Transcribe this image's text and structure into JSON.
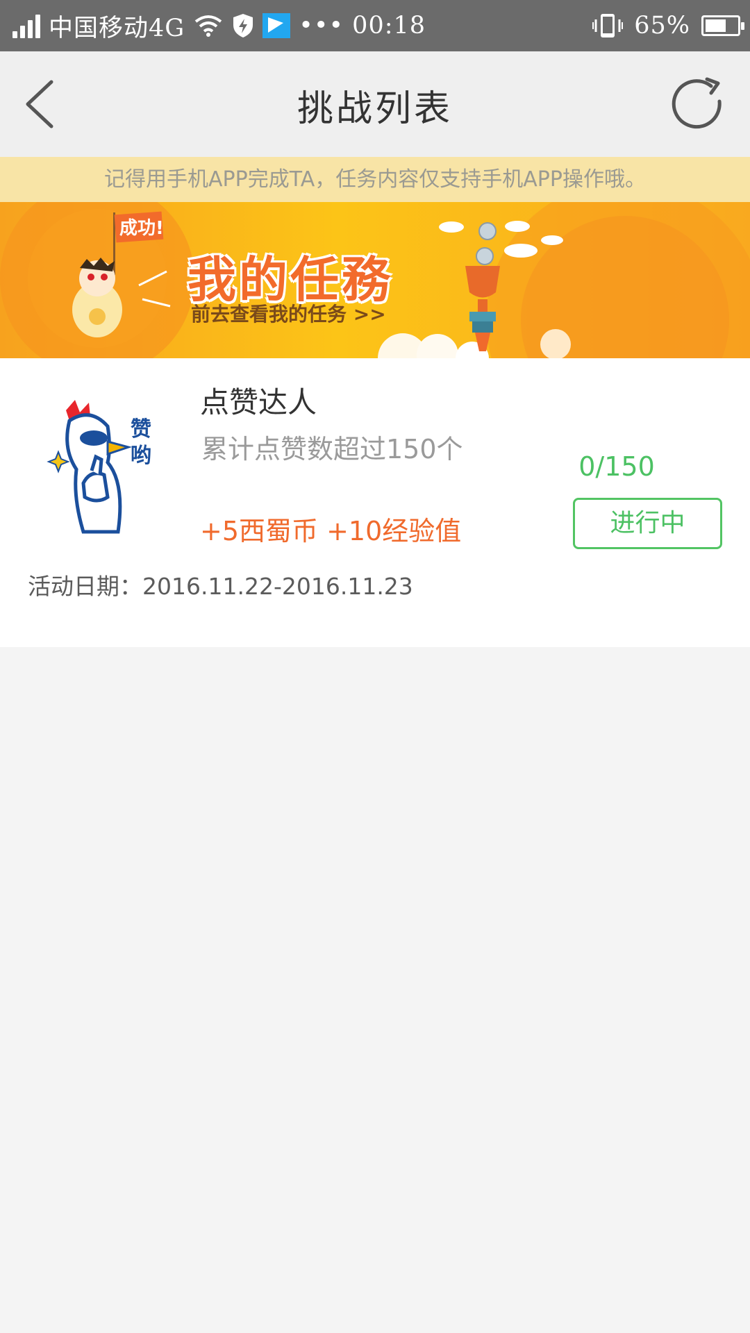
{
  "status_bar": {
    "carrier": "中国移动4G",
    "time": "00:18",
    "battery": "65%",
    "battery_level": 0.65,
    "icons": [
      "signal-icon",
      "wifi-icon",
      "shield-icon",
      "flag-icon",
      "more-dots-icon",
      "vibrate-icon",
      "battery-icon"
    ]
  },
  "header": {
    "title": "挑战列表",
    "back_icon": "chevron-left-icon",
    "refresh_icon": "refresh-icon"
  },
  "notice": {
    "text": "记得用手机APP完成TA，任务内容仅支持手机APP操作哦。"
  },
  "banner": {
    "title": "我的任務",
    "subtitle": "前去查看我的任务 >>",
    "flag_text": "成功!",
    "colors": {
      "background": "#fbb928",
      "title": "#f26b2b"
    }
  },
  "task": {
    "name": "点赞达人",
    "description": "累计点赞数超过150个",
    "reward": "+5西蜀币 +10经验值",
    "progress": "0/150",
    "status": "进行中",
    "date_label": "活动日期：",
    "date_range": "2016.11.22-2016.11.23",
    "logo_text": "赞哟",
    "colors": {
      "reward": "#f06a2c",
      "progress": "#4cc163"
    }
  }
}
